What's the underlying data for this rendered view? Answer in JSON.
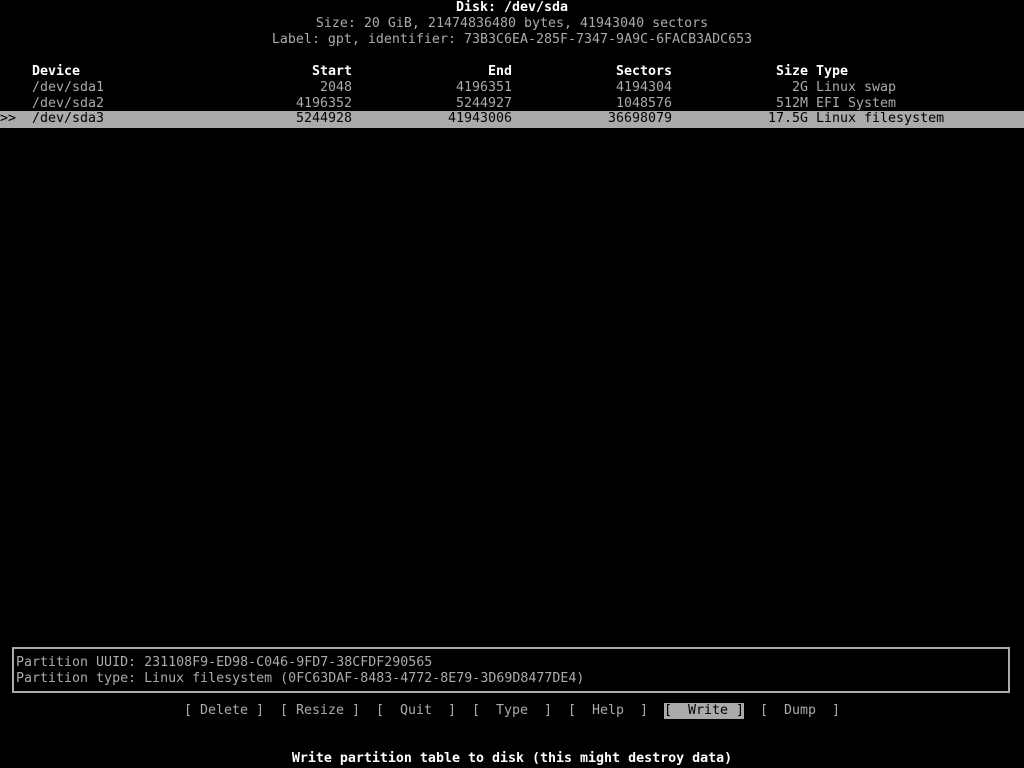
{
  "header": {
    "disk_title": "Disk: /dev/sda",
    "size_line": "Size: 20 GiB, 21474836480 bytes, 41943040 sectors",
    "label_line": "Label: gpt, identifier: 73B3C6EA-285F-7347-9A9C-6FACB3ADC653"
  },
  "table": {
    "columns": [
      "Device",
      "Start",
      "End",
      "Sectors",
      "Size",
      "Type"
    ],
    "selection_marker": ">>",
    "rows": [
      {
        "device": "/dev/sda1",
        "start": "2048",
        "end": "4196351",
        "sectors": "4194304",
        "size": "2G",
        "type": "Linux swap",
        "selected": false
      },
      {
        "device": "/dev/sda2",
        "start": "4196352",
        "end": "5244927",
        "sectors": "1048576",
        "size": "512M",
        "type": "EFI System",
        "selected": false
      },
      {
        "device": "/dev/sda3",
        "start": "5244928",
        "end": "41943006",
        "sectors": "36698079",
        "size": "17.5G",
        "type": "Linux filesystem",
        "selected": true
      }
    ]
  },
  "info": {
    "uuid_line": "Partition UUID: 231108F9-ED98-C046-9FD7-38CFDF290565",
    "type_line": "Partition type: Linux filesystem (0FC63DAF-8483-4772-8E79-3D69D8477DE4)"
  },
  "menu": {
    "buttons": [
      {
        "label": "[ Delete ]",
        "active": false
      },
      {
        "label": "[ Resize ]",
        "active": false
      },
      {
        "label": "[  Quit  ]",
        "active": false
      },
      {
        "label": "[  Type  ]",
        "active": false
      },
      {
        "label": "[  Help  ]",
        "active": false
      },
      {
        "label": "[  Write ]",
        "active": true
      },
      {
        "label": "[  Dump  ]",
        "active": false
      }
    ]
  },
  "status": {
    "message": "Write partition table to disk (this might destroy data)"
  }
}
